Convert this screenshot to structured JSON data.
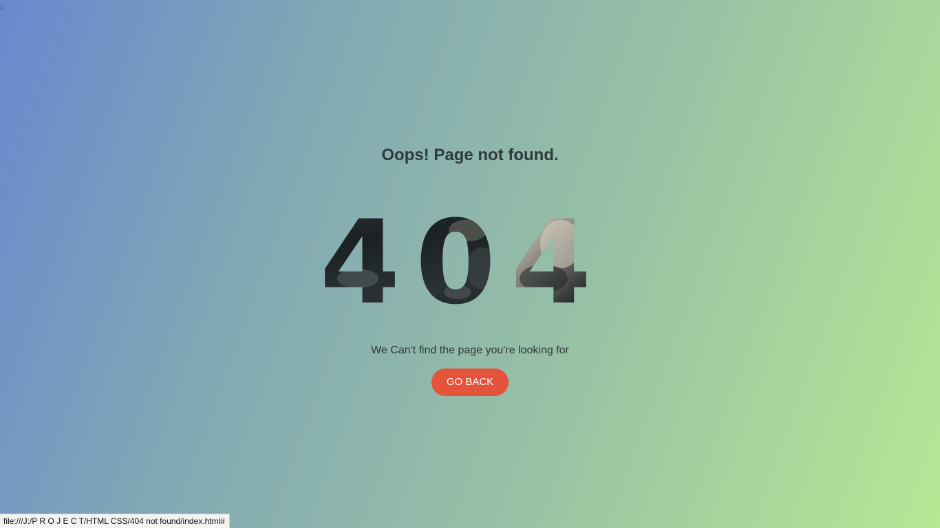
{
  "page": {
    "stray_text": ";",
    "headline": "Oops! Page not found.",
    "error_code": "404",
    "message": "We Can't find the page you're looking for",
    "back_button_label": "GO BACK"
  },
  "status_bar": {
    "url": "file:///J:/P R O J E C T/HTML CSS/404 not found/index.html#"
  },
  "colors": {
    "background_start": "#6a87cf",
    "background_end": "#b4e894",
    "button": "#e4533c",
    "text": "#2f3a3c"
  }
}
